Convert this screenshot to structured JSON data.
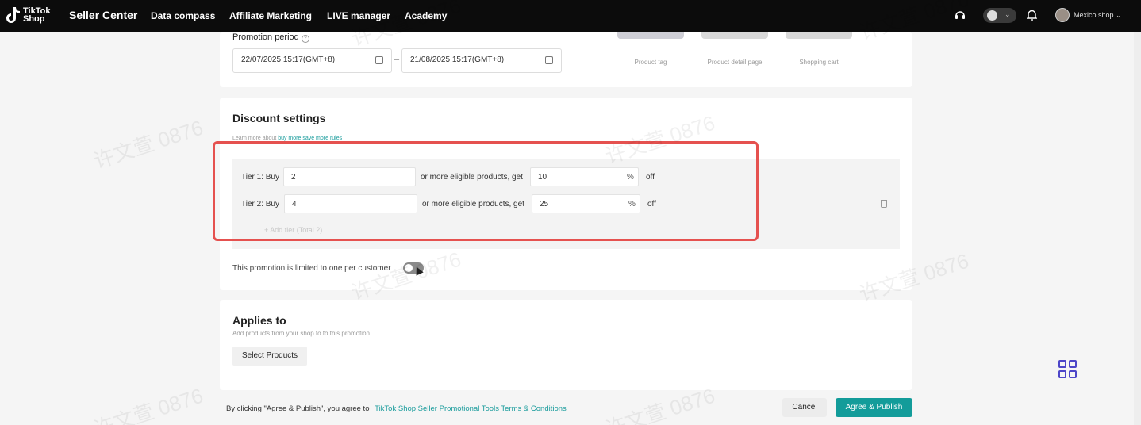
{
  "nav": {
    "logo_line1": "TikTok",
    "logo_line2": "Shop",
    "brand": "Seller Center",
    "items": [
      "Data compass",
      "Affiliate Marketing",
      "LIVE manager",
      "Academy"
    ],
    "shop_name": "Mexico shop",
    "icons": [
      "headset-icon",
      "chat-icon",
      "bell-icon"
    ]
  },
  "promotion_period": {
    "label": "Promotion period",
    "start": "22/07/2025 15:17(GMT+8)",
    "separator": "–",
    "end": "21/08/2025 15:17(GMT+8)"
  },
  "preview": {
    "labels": [
      "Product tag",
      "Product detail page",
      "Shopping cart"
    ]
  },
  "discount": {
    "title": "Discount settings",
    "hint_prefix": "Learn more about ",
    "hint_link": "buy more save more rules",
    "tiers": [
      {
        "label": "Tier 1: Buy",
        "quantity": "2",
        "middle": "or more eligible products, get",
        "percent": "10",
        "pct_sign": "%",
        "suffix": "off"
      },
      {
        "label": "Tier 2: Buy",
        "quantity": "4",
        "middle": "or more eligible products, get",
        "percent": "25",
        "pct_sign": "%",
        "suffix": "off"
      }
    ],
    "add_tier": "+ Add tier",
    "add_tier_count": "(Total 2)",
    "limit_label": "This promotion is limited to one per customer",
    "limit_enabled": false
  },
  "applies": {
    "title": "Applies to",
    "hint": "Add products from your shop to to this promotion.",
    "select_button": "Select Products"
  },
  "footer": {
    "terms_prefix": "By clicking \"Agree & Publish\", you agree to",
    "terms_link": "TikTok Shop Seller Promotional Tools Terms & Conditions",
    "cancel": "Cancel",
    "publish": "Agree & Publish"
  },
  "watermark": "许文萱 0876",
  "colors": {
    "accent": "#139c9a",
    "highlight": "#e5514f",
    "grid_icon": "#4d46c8"
  }
}
